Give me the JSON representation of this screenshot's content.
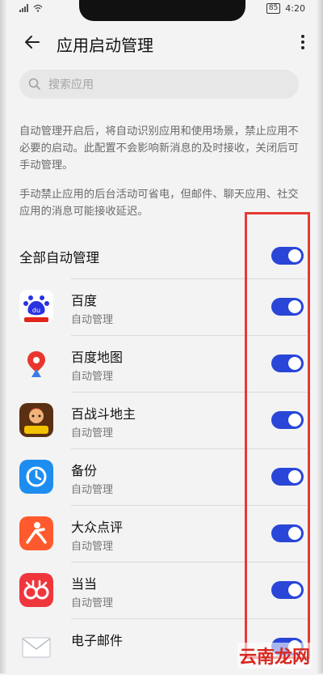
{
  "status_bar": {
    "time": "4:20",
    "battery": "85"
  },
  "header": {
    "title": "应用启动管理"
  },
  "search": {
    "placeholder": "搜索应用"
  },
  "description": {
    "para1": "自动管理开启后，将自动识别应用和使用场景，禁止应用不必要的启动。此配置不会影响新消息的及时接收，关闭后可手动管理。",
    "para2": "手动禁止应用的后台活动可省电，但邮件、聊天应用、社交应用的消息可能接收延迟。"
  },
  "all_auto": {
    "label": "全部自动管理",
    "enabled": true
  },
  "apps": [
    {
      "name": "百度",
      "status": "自动管理",
      "icon": "baidu-icon",
      "enabled": true
    },
    {
      "name": "百度地图",
      "status": "自动管理",
      "icon": "baidu-map-icon",
      "enabled": true
    },
    {
      "name": "百战斗地主",
      "status": "自动管理",
      "icon": "doudizhu-icon",
      "enabled": true
    },
    {
      "name": "备份",
      "status": "自动管理",
      "icon": "backup-icon",
      "enabled": true
    },
    {
      "name": "大众点评",
      "status": "自动管理",
      "icon": "dianping-icon",
      "enabled": true
    },
    {
      "name": "当当",
      "status": "自动管理",
      "icon": "dangdang-icon",
      "enabled": true
    },
    {
      "name": "电子邮件",
      "status": "",
      "icon": "email-icon",
      "enabled": true
    }
  ],
  "colors": {
    "toggle_on": "#2946d8",
    "annotation": "#e53935"
  },
  "watermark": "云南龙网"
}
